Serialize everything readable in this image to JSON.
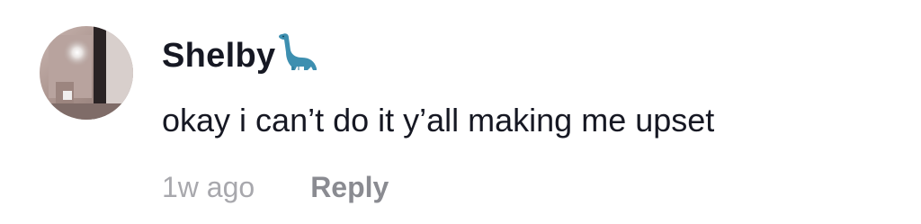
{
  "comment": {
    "author": "Shelby",
    "author_emoji": "dinosaur-emoji",
    "text": "okay i can’t do it y’all making me upset",
    "time": "1w ago",
    "reply_label": "Reply"
  },
  "colors": {
    "text": "#161823",
    "muted": "#a8a8ad",
    "reply": "#8a8b91",
    "dino": "#3d8fb0"
  }
}
